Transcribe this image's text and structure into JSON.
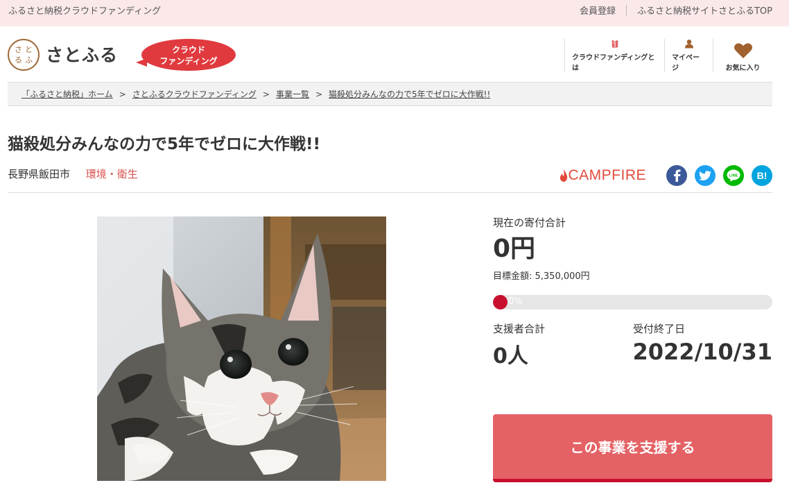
{
  "topbar": {
    "site_name": "ふるさと納税クラウドファンディング",
    "links": [
      "会員登録",
      "ふるさと納税サイトさとふるTOP"
    ]
  },
  "header": {
    "seal_chars": [
      "さ",
      "と",
      "る",
      "ふ"
    ],
    "logo_text": "さとふる",
    "badge_line1": "クラウド",
    "badge_line2": "ファンディング",
    "nav": [
      {
        "label": "クラウドファンディングとは",
        "icon": "book-icon"
      },
      {
        "label": "マイページ",
        "icon": "user-icon"
      },
      {
        "label": "お気に入り",
        "icon": "heart-icon"
      }
    ]
  },
  "breadcrumb": [
    "「ふるさと納税」ホーム",
    "さとふるクラウドファンディング",
    "事業一覧",
    "猫殺処分みんなの力で5年でゼロに大作戦!!"
  ],
  "project": {
    "title": "猫殺処分みんなの力で5年でゼロに大作戦!!",
    "location": "長野県飯田市",
    "category": "環境・衛生"
  },
  "share": {
    "campfire": "CAMPFIRE",
    "icons": [
      "facebook-icon",
      "twitter-icon",
      "line-icon",
      "hatena-bookmark-icon"
    ]
  },
  "stats": {
    "total_label": "現在の寄付合計",
    "total_value": "0円",
    "goal_text": "目標金額: 5,350,000円",
    "progress_text": "0%",
    "progress_fraction": 0,
    "supporters_label": "支援者合計",
    "supporters_value": "0人",
    "deadline_label": "受付終了日",
    "deadline_value": "2022/10/31"
  },
  "support_button": "この事業を支援する",
  "colors": {
    "accent": "#e46265",
    "topbar_bg": "#fbe9ea",
    "category": "#d9534f",
    "progress_fill": "#c8102e"
  }
}
